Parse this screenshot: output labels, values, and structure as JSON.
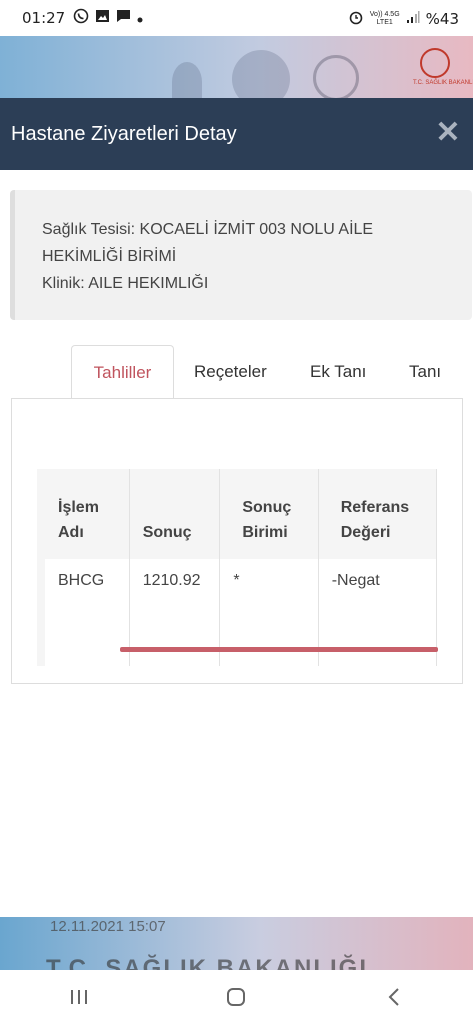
{
  "status_bar": {
    "time": "01:27",
    "left_icons": [
      "whatsapp-icon",
      "image-icon",
      "message-icon",
      "dot-icon"
    ],
    "right_icons": [
      "alarm-icon",
      "volte-icon",
      "4g-icon",
      "signal-icon"
    ],
    "network_top": "Vo)) 4.5G",
    "network_bottom": "LTE1",
    "battery": "%43"
  },
  "banner": {
    "logo_text": "T.C. SAĞLIK BAKANLIĞI"
  },
  "modal": {
    "title": "Hastane Ziyaretleri Detay",
    "close_label": "✕"
  },
  "info": {
    "facility_line1": "Sağlık Tesisi: KOCAELİ İZMİT 003 NOLU AİLE",
    "facility_line2": "HEKİMLİĞİ BİRİMİ",
    "clinic": "Klinik: AILE HEKIMLIĞI"
  },
  "tabs": [
    {
      "label": "Tahliller",
      "active": true
    },
    {
      "label": "Reçeteler",
      "active": false
    },
    {
      "label": "Ek Tanı",
      "active": false
    },
    {
      "label": "Tanı",
      "active": false
    }
  ],
  "table": {
    "headers": [
      {
        "line1": "İşlem",
        "line2": "Adı"
      },
      {
        "line1": "",
        "line2": "Sonuç"
      },
      {
        "line1": "Sonuç",
        "line2": "Birimi"
      },
      {
        "line1": "Referans",
        "line2": "Değeri"
      }
    ],
    "rows": [
      [
        "BHCG",
        "1210.92",
        "*",
        "-Negat"
      ]
    ]
  },
  "footer_peek": {
    "date": "12.11.2021 15:07",
    "text": "T.C. SAĞLIK BAKANLIĞI"
  },
  "colors": {
    "header_bg": "#2c3e56",
    "active_tab": "#c0545e",
    "scrollbar": "#c75f69"
  }
}
